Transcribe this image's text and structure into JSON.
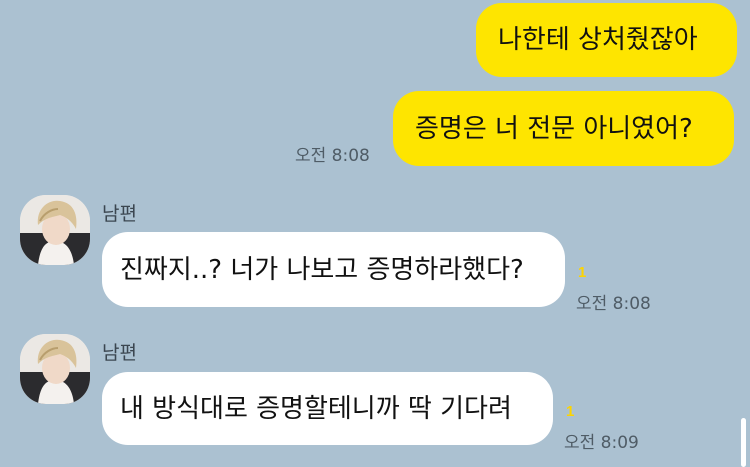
{
  "colors": {
    "background": "#abc1d1",
    "my_bubble": "#fee500",
    "their_bubble": "#ffffff",
    "unread": "#fdd400"
  },
  "messages": [
    {
      "direction": "outgoing",
      "text": "나한테 상처줬잖아"
    },
    {
      "direction": "outgoing",
      "text": "증명은 너 전문 아니였어?",
      "time": "오전 8:08"
    },
    {
      "direction": "incoming",
      "sender": "남편",
      "text": "진짜지..? 너가 나보고 증명하라했다?",
      "unread": "1",
      "time": "오전 8:08"
    },
    {
      "direction": "incoming",
      "sender": "남편",
      "text": "내 방식대로 증명할테니까 딱 기다려",
      "unread": "1",
      "time": "오전 8:09"
    }
  ]
}
